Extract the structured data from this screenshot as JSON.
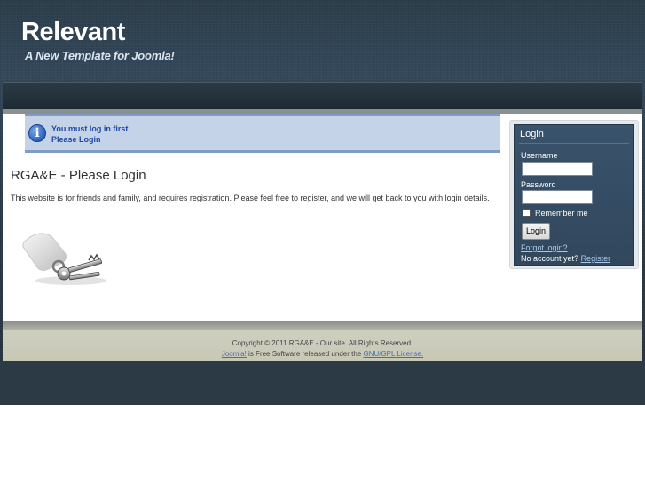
{
  "header": {
    "site_title": "Relevant",
    "tagline": "A New Template for Joomla!"
  },
  "notice": {
    "icon": "info-icon",
    "line1": "You must log in first",
    "line2": "Please Login"
  },
  "main": {
    "heading": "RGA&E - Please Login",
    "intro": "This website is for friends and family, and requires registration.  Please feel free to register, and we will get back to you with login details.",
    "image": "keys-image"
  },
  "login": {
    "title": "Login",
    "username_label": "Username",
    "username_value": "",
    "password_label": "Password",
    "password_value": "",
    "remember_label": "Remember me",
    "remember_checked": false,
    "button_label": "Login",
    "forgot_label": "Forgot login?",
    "no_account_text": "No account yet?",
    "register_label": "Register"
  },
  "footer": {
    "copyright": "Copyright © 2011 RGA&E - Our site. All Rights Reserved.",
    "joomla_link": "Joomla!",
    "free_software_text": " is Free Software released under the ",
    "license_link": "GNU/GPL License."
  },
  "colors": {
    "backdrop": "#2c3d4a",
    "notice_bg": "#c4d3e7",
    "notice_text": "#1f47a8",
    "login_bg": "#39536c",
    "footer_bg": "#cfcfc0"
  }
}
